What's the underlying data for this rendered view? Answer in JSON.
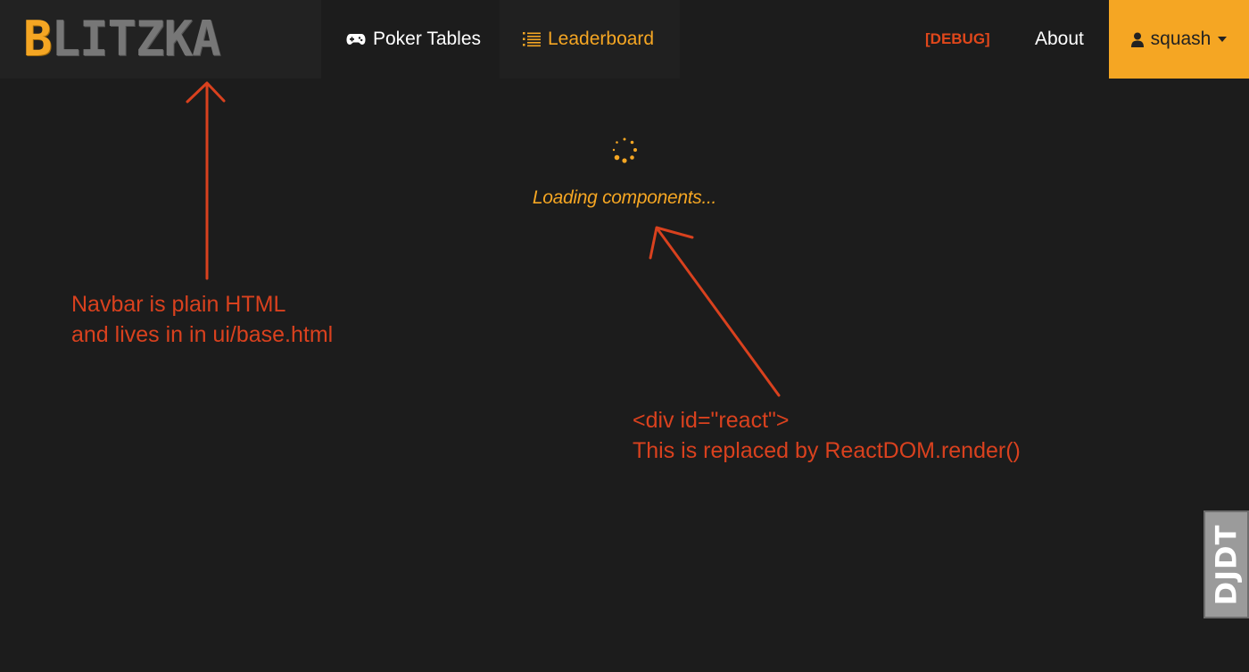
{
  "navbar": {
    "brand_letters": [
      "B",
      "L",
      "I",
      "T",
      "Z",
      "K",
      "A"
    ],
    "items": [
      {
        "label": "Poker Tables",
        "icon": "gamepad-icon"
      },
      {
        "label": "Leaderboard",
        "icon": "list-icon"
      }
    ],
    "debug_label": "[DEBUG]",
    "about_label": "About",
    "user": {
      "name": "squash",
      "icon": "user-icon"
    }
  },
  "loader": {
    "text": "Loading components..."
  },
  "annotations": {
    "navbar_note": {
      "line1": "Navbar is plain HTML",
      "line2": "and lives in in ui/base.html"
    },
    "react_note": {
      "line1": "<div id=\"react\">",
      "line2": "This is replaced by ReactDOM.render()"
    }
  },
  "debug_toolbar": {
    "label": "DJDT"
  },
  "colors": {
    "background": "#1c1c1c",
    "accent": "#f5a623",
    "annotation": "#d9411e",
    "debug": "#e0471b"
  }
}
